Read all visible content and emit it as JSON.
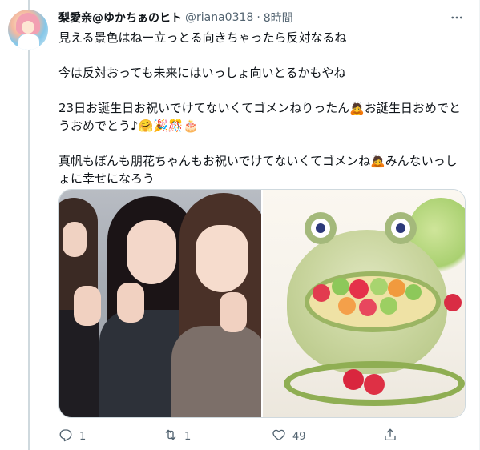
{
  "tweet": {
    "author_name": "梨愛亲@ゆかちぁのヒト",
    "handle": "@riana0318",
    "separator": "·",
    "time": "8時間",
    "paragraphs": [
      "見える景色はねー立っとる向きちゃったら反対なるね",
      "今は反対おっても未来にはいっしょ向いとるかもやね",
      "23日お誕生日お祝いでけてないくてゴメンねりったん🙇お誕生日おめでとうおめでとう♪🤗🎉🎊🎂",
      "真帆もぽんも朋花ちゃんもお祝いでけてないくてゴメンね🙇みんないっしょに幸せになろう"
    ]
  },
  "actions": {
    "reply_count": "1",
    "retweet_count": "1",
    "like_count": "49"
  },
  "icons": {
    "more": "more-icon",
    "reply": "reply-icon",
    "retweet": "retweet-icon",
    "like": "heart-icon",
    "share": "share-icon"
  },
  "colors": {
    "text_primary": "#0f1419",
    "text_secondary": "#536471",
    "border": "#cfd9de"
  }
}
